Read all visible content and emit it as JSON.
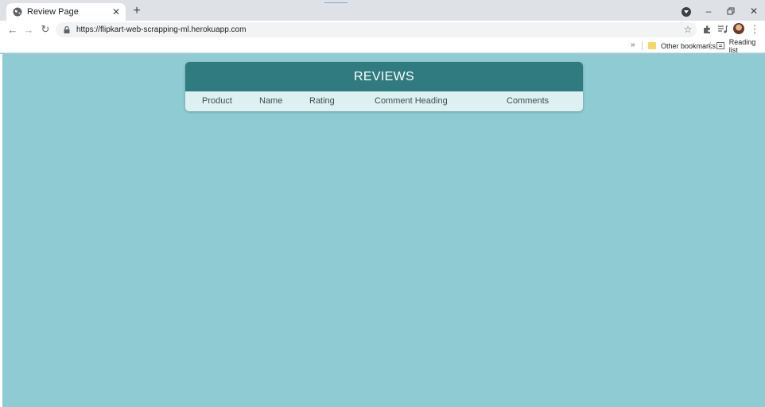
{
  "browser": {
    "tab_title": "Review Page",
    "new_tab_symbol": "+",
    "url": "https://flipkart-web-scrapping-ml.herokuapp.com",
    "bookmarks_overflow": "»",
    "bookmarks": [
      "Other bookmarks",
      "Reading list"
    ],
    "icons": [
      "globe-icon",
      "close-icon",
      "back-icon",
      "forward-icon",
      "reload-icon",
      "lock-icon",
      "star-icon",
      "extensions-icon",
      "media-icon",
      "menu-icon",
      "minimize-icon",
      "restore-icon",
      "tab-search-icon",
      "folder-icon",
      "reading-list-icon"
    ]
  },
  "page": {
    "heading": "REVIEWS",
    "columns": [
      "Product",
      "Name",
      "Rating",
      "Comment Heading",
      "Comments"
    ]
  },
  "colors": {
    "background": "#8fcbd3",
    "header": "#2f7b80",
    "column_bar": "#ddf0f2"
  }
}
